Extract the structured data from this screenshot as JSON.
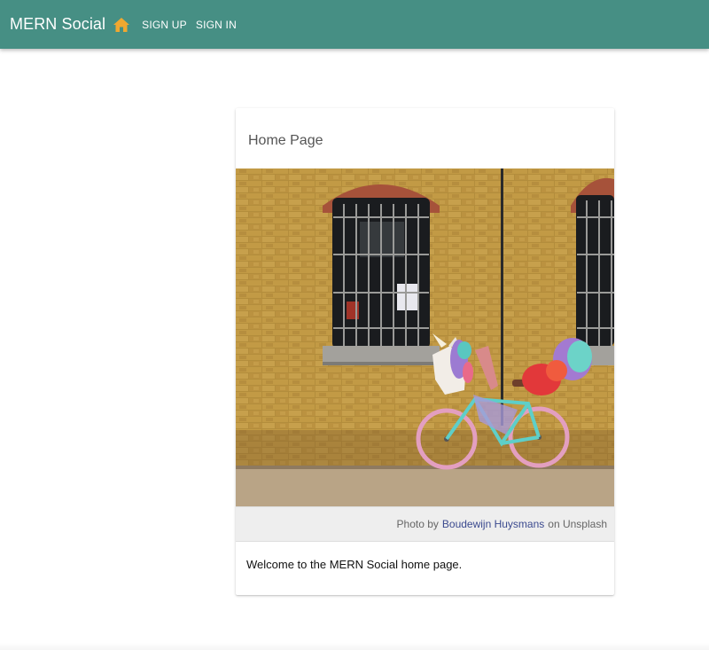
{
  "header": {
    "title": "MERN Social",
    "home_icon": "home-icon",
    "home_color": "#f0a830",
    "nav": {
      "signup_label": "SIGN UP",
      "signin_label": "SIGN IN"
    },
    "bar_color": "#468f84"
  },
  "card": {
    "title": "Home Page",
    "caption": {
      "prefix": "Photo by",
      "author": "Boudewijn Huysmans",
      "suffix": "on Unsplash"
    },
    "body_text": "Welcome to the MERN Social home page."
  }
}
